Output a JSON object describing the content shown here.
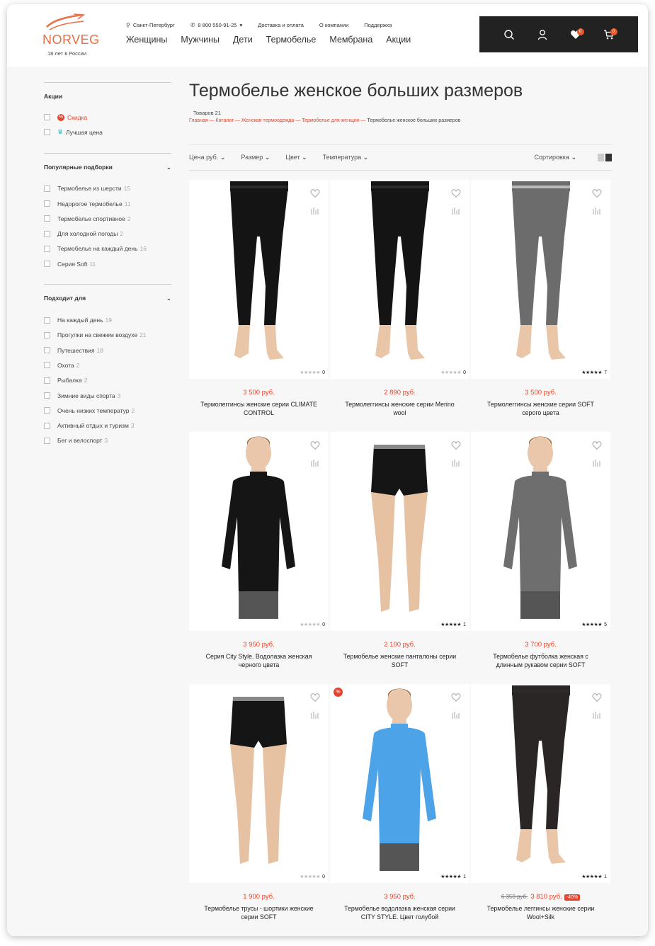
{
  "header": {
    "logo": {
      "brand": "NORVEG",
      "tagline": "18 лет в России"
    },
    "topbar": {
      "city": "Санкт-Петербург",
      "phone": "8 800 550-91-25",
      "phone_dropdown": "▾",
      "links": [
        "Доставка и оплата",
        "О компании",
        "Поддержка"
      ]
    },
    "nav": [
      "Женщины",
      "Мужчины",
      "Дети",
      "Термобелье",
      "Мембрана",
      "Акции"
    ],
    "icons": {
      "search": "search-icon",
      "account": "user-icon",
      "wishlist_count": "0",
      "cart_count": "0"
    }
  },
  "sidebar": {
    "promo": {
      "title": "Акции",
      "items": [
        {
          "label": "Скидка",
          "icon": "discount-icon"
        },
        {
          "label": "Лучшая цена",
          "icon": "crown-icon"
        }
      ]
    },
    "popular": {
      "title": "Популярные подборки",
      "items": [
        {
          "label": "Термобелье из шерсти",
          "count": "15"
        },
        {
          "label": "Недорогое термобелье",
          "count": "11"
        },
        {
          "label": "Термобелье спортивное",
          "count": "2"
        },
        {
          "label": "Для холодной погоды",
          "count": "2"
        },
        {
          "label": "Термобелье на каждый день",
          "count": "16"
        },
        {
          "label": "Серия Soft",
          "count": "11"
        }
      ]
    },
    "suitable": {
      "title": "Подходит для",
      "items": [
        {
          "label": "На каждый день",
          "count": "19"
        },
        {
          "label": "Прогулки на свежем воздухе",
          "count": "21"
        },
        {
          "label": "Путешествия",
          "count": "18"
        },
        {
          "label": "Охота",
          "count": "2"
        },
        {
          "label": "Рыбалка",
          "count": "2"
        },
        {
          "label": "Зимние виды спорта",
          "count": "3"
        },
        {
          "label": "Очень низких температур",
          "count": "2"
        },
        {
          "label": "Активный отдых и туризм",
          "count": "3"
        },
        {
          "label": "Бег и велоспорт",
          "count": "3"
        }
      ]
    }
  },
  "main": {
    "title": "Термобелье женское больших размеров",
    "count": "Товаров 21",
    "breadcrumbs": [
      "Главная",
      "Каталог",
      "Женская термоодежда",
      "Термобелье для женщин"
    ],
    "breadcrumb_current": "Термобелье женское больших размеров",
    "filters": [
      "Цена руб.",
      "Размер",
      "Цвет",
      "Температура"
    ],
    "sort_label": "Сортировка",
    "products": [
      {
        "price": "3 500 руб.",
        "name": "Термолеггинсы женские серии CLIMATE CONTROL",
        "rating": 0,
        "reviews": "0",
        "type": "leggings",
        "color": "#141414",
        "skin": "#e9c6a8"
      },
      {
        "price": "2 890 руб.",
        "name": "Термолеггинсы женские серии Merino wool",
        "rating": 0,
        "reviews": "0",
        "type": "leggings",
        "color": "#141414",
        "skin": "#e9c6a8"
      },
      {
        "price": "3 500 руб.",
        "name": "Термолеггинсы женские серии SOFT серого цвета",
        "rating": 5,
        "reviews": "7",
        "type": "leggings",
        "color": "#6c6c6c",
        "skin": "#e9c6a8"
      },
      {
        "price": "3 950 руб.",
        "name": "Серия City Style. Водолазка женская черного цвета",
        "rating": 0,
        "reviews": "0",
        "type": "top",
        "color": "#151515",
        "skin": "#eac6aa"
      },
      {
        "price": "2 100 руб.",
        "name": "Термобелье женские панталоны серии SOFT",
        "rating": 5,
        "reviews": "1",
        "type": "shorts",
        "color": "#151515",
        "skin": "#e6c2a2"
      },
      {
        "price": "3 700 руб.",
        "name": "Термобелье футболка женская с длинным рукавом серии SOFT",
        "rating": 5,
        "reviews": "5",
        "type": "top",
        "color": "#6e6e6e",
        "skin": "#eac6aa"
      },
      {
        "price": "1 900 руб.",
        "name": "Термобелье трусы - шортики женские серии SOFT",
        "rating": 0,
        "reviews": "0",
        "type": "shorts",
        "color": "#151515",
        "skin": "#e6c2a2"
      },
      {
        "price": "3 950 руб.",
        "name": "Термобелье водолазка женская серии CITY STYLE. Цвет голубой",
        "rating": 5,
        "reviews": "1",
        "type": "top",
        "color": "#4da3e8",
        "skin": "#eac6aa",
        "sale_badge": "%"
      },
      {
        "price": "3 810 руб.",
        "old_price": "6 350 руб.",
        "discount": "-40%",
        "name": "Термобелье леггинсы женские серии Wool+Silk",
        "rating": 5,
        "reviews": "1",
        "type": "leggings",
        "color": "#2a2626",
        "skin": "#e9c6a8"
      }
    ]
  }
}
